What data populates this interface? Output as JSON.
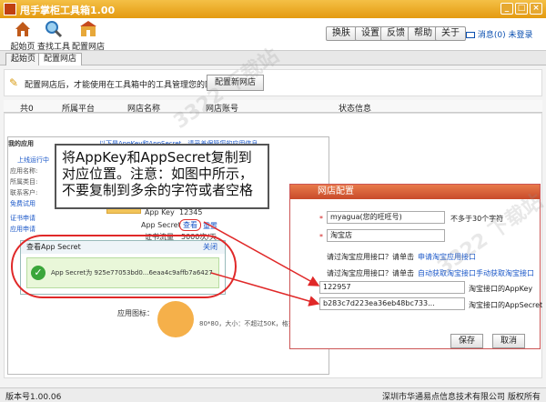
{
  "window": {
    "title": "甩手掌柜工具箱1.00",
    "controls": [
      "_",
      "□",
      "×"
    ]
  },
  "toolbar": {
    "home": "起始页",
    "find_tools": "查找工具",
    "config_shop": "配置网店",
    "right_buttons": [
      "换肤",
      "设置",
      "反馈",
      "帮助",
      "关于"
    ],
    "messages": "消息(0)",
    "login": "未登录"
  },
  "tabs": [
    "起始页",
    "配置网店"
  ],
  "infobar": {
    "text": "配置网店后，才能使用在工具箱中的工具管理您的网店",
    "button": "配置新网店"
  },
  "table": {
    "headers": [
      "共0",
      "所属平台",
      "网店名称",
      "网店账号",
      "状态信息"
    ]
  },
  "web_screenshot": {
    "title": "我的应用",
    "sidebar": [
      "上线运行中",
      "应用名称:",
      "所属类目:",
      "联系客户:",
      "免费试用",
      "AppKey:",
      "Appkey",
      "证书申请",
      "应用申请"
    ],
    "appkey_label": "App Key",
    "appkey_value": "12345",
    "appsecret_label": "App Secret",
    "view_link": "查看",
    "reset_link": "重置",
    "cert_label": "证书流量",
    "cert_value": "5000次/天",
    "app_icon_label": "应用图标：",
    "app_icon_hint": "80*80，大小：不超过50K，格式：jpg/png",
    "top_text": "以下是AppKey和AppSecret，请妥善保管您的应用信息"
  },
  "secret_popup": {
    "title": "查看App Secret",
    "close": "关闭",
    "text": "App Secret为 925e77053bd0...6eaa4c9affb7a6427"
  },
  "callout": {
    "text": "将AppKey和AppSecret复制到对应位置。注意：如图中所示，不要复制到多余的字符或者空格"
  },
  "dialog": {
    "title": "网店配置",
    "shop_name_value": "myagua(您的旺旺号)",
    "shop_name_hint": "不多于30个字符",
    "platform_value": "淘宝店",
    "row3_label": "请过淘宝应用接口？请单击",
    "row3_link": "申请淘宝应用接口",
    "row4_label": "请过淘宝应用接口？请单击",
    "row4_link1": "自动获取淘宝接口",
    "row4_link2": "手动获取淘宝接口",
    "appkey_value": "122957",
    "appkey_label": "淘宝接口的AppKey",
    "secret_value": "b283c7d223ea36eb48bc733...",
    "secret_label": "淘宝接口的AppSecret",
    "save": "保存",
    "cancel": "取消"
  },
  "statusbar": {
    "version": "版本号1.00.06",
    "company": "深圳市华通易点信息技术有限公司 版权所有"
  },
  "watermark": "3322 下载站"
}
